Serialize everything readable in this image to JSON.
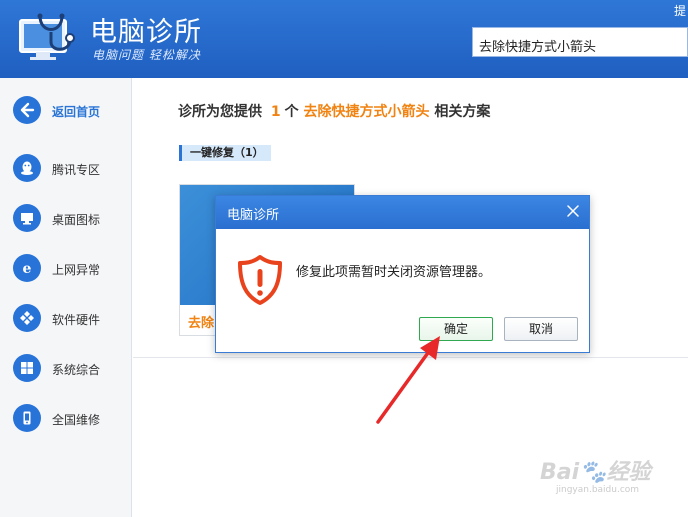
{
  "header": {
    "app_title": "电脑诊所",
    "app_slogan": "电脑问题 轻松解决",
    "search_value": "去除快捷方式小箭头",
    "corner_text": "提"
  },
  "sidebar": {
    "items": [
      {
        "label": "返回首页",
        "icon": "back-arrow-icon"
      },
      {
        "label": "腾讯专区",
        "icon": "qq-penguin-icon"
      },
      {
        "label": "桌面图标",
        "icon": "monitor-icon"
      },
      {
        "label": "上网异常",
        "icon": "ie-browser-icon"
      },
      {
        "label": "软件硬件",
        "icon": "puzzle-icon"
      },
      {
        "label": "系统综合",
        "icon": "windows-icon"
      },
      {
        "label": "全国维修",
        "icon": "phone-icon"
      }
    ]
  },
  "main": {
    "headline_prefix": "诊所为您提供",
    "headline_count": "1",
    "headline_mid": "个",
    "headline_keyword": "去除快捷方式小箭头",
    "headline_suffix": "相关方案",
    "section_tag": "一键修复（1）",
    "card_label": "去除"
  },
  "dialog": {
    "title": "电脑诊所",
    "message": "修复此项需暂时关闭资源管理器。",
    "ok_label": "确定",
    "cancel_label": "取消"
  },
  "watermark": {
    "brand": "Bai",
    "brand_cn": "经验",
    "url": "jingyan.baidu.com"
  },
  "colors": {
    "header_blue": "#2a6fd0",
    "accent_orange": "#f08312",
    "warning_red": "#e8431c",
    "ok_border_green": "#2fa84f",
    "annotation_red": "#e8292a"
  }
}
